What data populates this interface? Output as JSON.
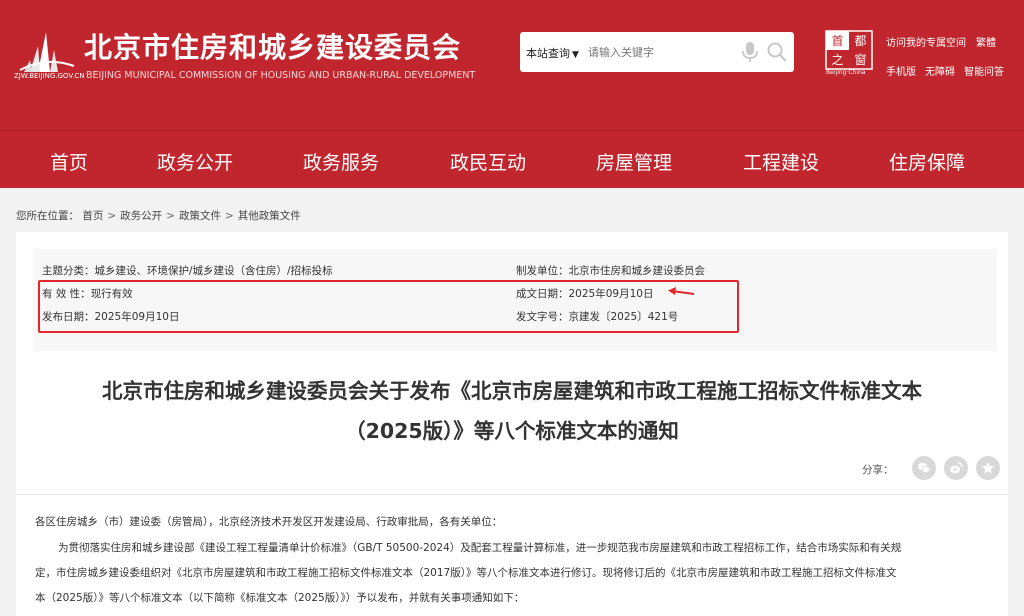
{
  "header": {
    "logo_url_text": "ZJW.BEIJING.GOV.CN",
    "site_title": "北京市住房和城乡建设委员会",
    "site_subtitle": "BEIJING MUNICIPAL COMMISSION OF HOUSING AND URBAN-RURAL DEVELOPMENT",
    "search_scope": "本站查询",
    "search_placeholder": "请输入关键字",
    "capital_logo_text": "Beijing·China",
    "capital_logo_glyphs": [
      "首",
      "之",
      "都",
      "窗"
    ],
    "top_links_row1": [
      "访问我的专属空间",
      "繁體"
    ],
    "top_links_row2": [
      "手机版",
      "无障碍",
      "智能问答"
    ]
  },
  "nav": {
    "items": [
      "首页",
      "政务公开",
      "政务服务",
      "政民互动",
      "房屋管理",
      "工程建设",
      "住房保障"
    ]
  },
  "breadcrumb": {
    "prefix": "您所在位置：",
    "items": [
      "首页",
      "政务公开",
      "政策文件",
      "其他政策文件"
    ]
  },
  "meta": {
    "topic_label": "主题分类：",
    "topic_value": "城乡建设、环境保护/城乡建设（含住房）/招标投标",
    "issuer_label": "制发单位：",
    "issuer_value": "北京市住房和城乡建设委员会",
    "validity_label": "有 效 性：",
    "validity_value": "现行有效",
    "date_written_label": "成文日期：",
    "date_written_value": "2025年09月10日",
    "publish_date_label": "发布日期：",
    "publish_date_value": "2025年09月10日",
    "doc_number_label": "发文字号：",
    "doc_number_value": "京建发〔2025〕421号"
  },
  "article": {
    "title_line1": "北京市住房和城乡建设委员会关于发布《北京市房屋建筑和市政工程施工招标文件标准文本",
    "title_line2": "（2025版）》等八个标准文本的通知",
    "share_label": "分享：",
    "para_salutation": "各区住房城乡（市）建设委（房管局），北京经济技术开发区开发建设局、行政审批局，各有关单位：",
    "para1_line1": "为贯彻落实住房和城乡建设部《建设工程工程量清单计价标准》（GB/T 50500-2024）及配套工程量计算标准，进一步规范我市房屋建筑和市政工程招标工作，结合市场实际和有关规",
    "para1_line2": "定，市住房城乡建设委组织对《北京市房屋建筑和市政工程施工招标文件标准文本（2017版）》等八个标准文本进行修订。现将修订后的《北京市房屋建筑和市政工程施工招标文件标准文",
    "para1_line3": "本（2025版）》等八个标准文本（以下简称《标准文本（2025版）》）予以发布，并就有关事项通知如下："
  },
  "colors": {
    "brand_red": "#c1262e",
    "highlight_red": "#e4272e"
  }
}
